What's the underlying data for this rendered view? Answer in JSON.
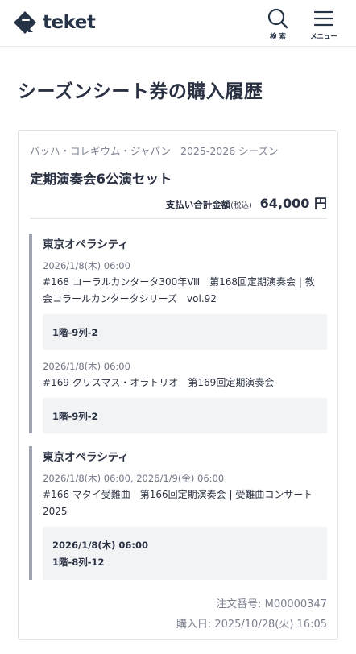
{
  "header": {
    "logo_text": "teket",
    "search_label": "検 索",
    "menu_label": "メニュー"
  },
  "page_title": "シーズンシート券の購入履歴",
  "purchase": {
    "organizer": "バッハ・コレギウム・ジャパン",
    "season": "2025-2026 シーズン",
    "set_name": "定期演奏会6公演セット",
    "total_label": "支払い合計金額",
    "tax_note": "(税込)",
    "total_amount": "64,000 円",
    "groups": [
      {
        "venue": "東京オペラシティ",
        "performances": [
          {
            "datetime": "2026/1/8(木) 06:00",
            "title": "#168 コーラルカンタータ300年Ⅷ　第168回定期演奏会 | 教会コラールカンタータシリーズ　vol.92",
            "seat": "1階-9列-2"
          },
          {
            "datetime": "2026/1/8(木) 06:00",
            "title": "#169 クリスマス・オラトリオ　第169回定期演奏会",
            "seat": "1階-9列-2"
          }
        ]
      },
      {
        "venue": "東京オペラシティ",
        "performances": [
          {
            "datetime": "2026/1/8(木) 06:00, 2026/1/9(金) 06:00",
            "title": "#166 マタイ受難曲　第166回定期演奏会 | 受難曲コンサート2025",
            "seat_datetime": "2026/1/8(木) 06:00",
            "seat": "1階-8列-12"
          }
        ]
      }
    ],
    "order_number": "注文番号: M00000347",
    "purchase_date": "購入日: 2025/10/28(火) 16:05"
  },
  "colors": {
    "text_primary": "#2a3142",
    "text_muted": "#7b8090",
    "group_bar": "#9ea3b2",
    "seat_box": "#f2f3f5"
  },
  "icons": [
    "teket-logo-icon",
    "search-icon",
    "hamburger-menu-icon"
  ]
}
